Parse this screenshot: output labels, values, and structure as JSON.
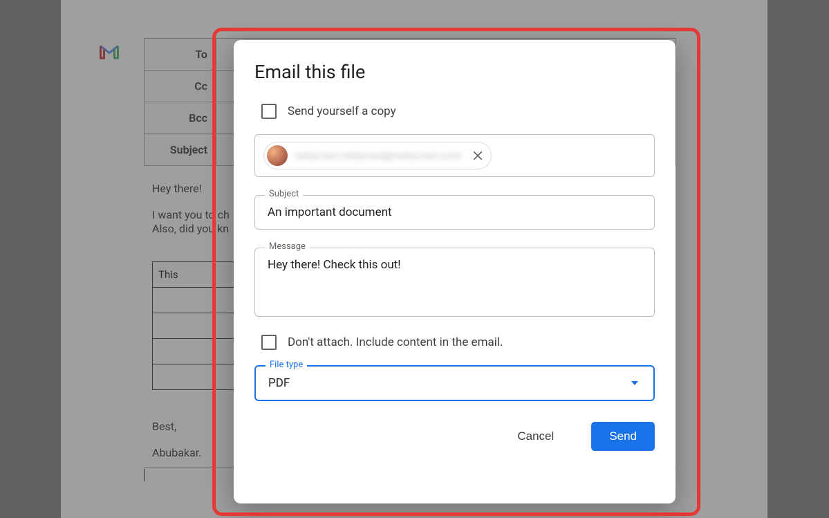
{
  "background": {
    "table_labels": {
      "to": "To",
      "cc": "Cc",
      "bcc": "Bcc",
      "subject": "Subject"
    },
    "greeting": "Hey there!",
    "body_line1": "I want you to ch",
    "body_line2": "Also, did you kn",
    "mini_cell": "This",
    "closing": "Best,",
    "signature": "Abubakar."
  },
  "dialog": {
    "title": "Email this file",
    "send_copy_label": "Send yourself a copy",
    "recipient_email": "redacted.redacted@redacted.com",
    "subject_legend": "Subject",
    "subject_value": "An important document",
    "message_legend": "Message",
    "message_value": "Hey there! Check this out!",
    "dont_attach_label": "Don't attach. Include content in the email.",
    "filetype_legend": "File type",
    "filetype_value": "PDF",
    "cancel_label": "Cancel",
    "send_label": "Send"
  }
}
